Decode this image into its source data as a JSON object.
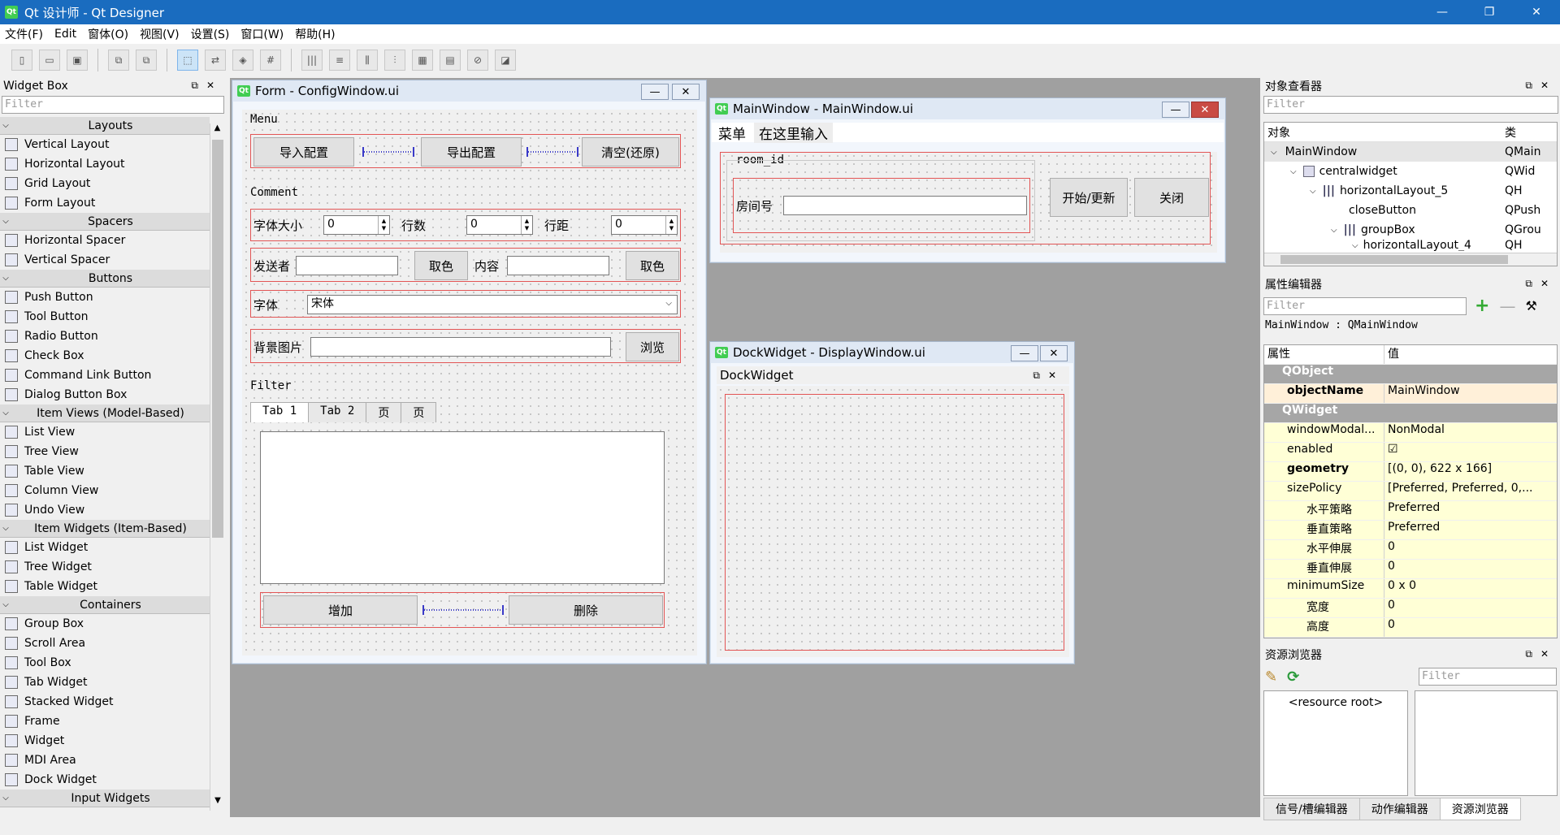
{
  "app": {
    "title": "Qt 设计师 - Qt Designer",
    "logo_text": "Qt"
  },
  "menu": [
    "文件(F)",
    "Edit",
    "窗体(O)",
    "视图(V)",
    "设置(S)",
    "窗口(W)",
    "帮助(H)"
  ],
  "widget_box": {
    "title": "Widget Box",
    "filter_placeholder": "Filter",
    "categories": [
      {
        "name": "Layouts",
        "items": [
          "Vertical Layout",
          "Horizontal Layout",
          "Grid Layout",
          "Form Layout"
        ]
      },
      {
        "name": "Spacers",
        "items": [
          "Horizontal Spacer",
          "Vertical Spacer"
        ]
      },
      {
        "name": "Buttons",
        "items": [
          "Push Button",
          "Tool Button",
          "Radio Button",
          "Check Box",
          "Command Link Button",
          "Dialog Button Box"
        ]
      },
      {
        "name": "Item Views (Model-Based)",
        "items": [
          "List View",
          "Tree View",
          "Table View",
          "Column View",
          "Undo View"
        ]
      },
      {
        "name": "Item Widgets (Item-Based)",
        "items": [
          "List Widget",
          "Tree Widget",
          "Table Widget"
        ]
      },
      {
        "name": "Containers",
        "items": [
          "Group Box",
          "Scroll Area",
          "Tool Box",
          "Tab Widget",
          "Stacked Widget",
          "Frame",
          "Widget",
          "MDI Area",
          "Dock Widget"
        ]
      },
      {
        "name": "Input Widgets",
        "items": []
      }
    ]
  },
  "config_window": {
    "title": "Form - ConfigWindow.ui",
    "menu_label": "Menu",
    "import_btn": "导入配置",
    "export_btn": "导出配置",
    "clear_btn": "清空(还原)",
    "comment_label": "Comment",
    "font_size_label": "字体大小",
    "font_size_val": "0",
    "rows_label": "行数",
    "rows_val": "0",
    "spacing_label": "行距",
    "spacing_val": "0",
    "sender_label": "发送者",
    "pick_color_1": "取色",
    "content_label": "内容",
    "pick_color_2": "取色",
    "font_label": "字体",
    "font_val": "宋体",
    "bg_label": "背景图片",
    "browse_btn": "浏览",
    "filter_label": "Filter",
    "tabs": [
      "Tab 1",
      "Tab 2",
      "页",
      "页"
    ],
    "add_btn": "增加",
    "delete_btn": "删除"
  },
  "main_window": {
    "title": "MainWindow - MainWindow.ui",
    "menu_item": "菜单",
    "menu_input": "在这里输入",
    "group_title": "room_id",
    "room_label": "房间号",
    "start_btn": "开始/更新",
    "close_btn": "关闭"
  },
  "dock_window": {
    "title": "DockWidget - DisplayWindow.ui",
    "dock_title": "DockWidget"
  },
  "object_inspector": {
    "title": "对象查看器",
    "filter_placeholder": "Filter",
    "col_object": "对象",
    "col_class": "类",
    "rows": [
      {
        "name": "MainWindow",
        "cls": "QMain"
      },
      {
        "name": "centralwidget",
        "cls": "QWid"
      },
      {
        "name": "horizontalLayout_5",
        "cls": "QH"
      },
      {
        "name": "closeButton",
        "cls": "QPush"
      },
      {
        "name": "groupBox",
        "cls": "QGrou"
      },
      {
        "name": "horizontalLayout_4",
        "cls": "QH"
      }
    ]
  },
  "property_editor": {
    "title": "属性编辑器",
    "filter_placeholder": "Filter",
    "context": "MainWindow : QMainWindow",
    "col_prop": "属性",
    "col_val": "值",
    "rows": [
      {
        "type": "cat",
        "name": "QObject",
        "val": ""
      },
      {
        "type": "o",
        "name": "objectName",
        "val": "MainWindow"
      },
      {
        "type": "cat",
        "name": "QWidget",
        "val": ""
      },
      {
        "type": "y",
        "name": "windowModal...",
        "val": "NonModal"
      },
      {
        "type": "y",
        "name": "enabled",
        "val": "☑"
      },
      {
        "type": "y",
        "name": "geometry",
        "val": "[(0, 0), 622 x 166]"
      },
      {
        "type": "y",
        "name": "sizePolicy",
        "val": "[Preferred, Preferred, 0,..."
      },
      {
        "type": "ys",
        "name": "水平策略",
        "val": "Preferred"
      },
      {
        "type": "ys",
        "name": "垂直策略",
        "val": "Preferred"
      },
      {
        "type": "ys",
        "name": "水平伸展",
        "val": "0"
      },
      {
        "type": "ys",
        "name": "垂直伸展",
        "val": "0"
      },
      {
        "type": "y",
        "name": "minimumSize",
        "val": "0 x 0"
      },
      {
        "type": "ys",
        "name": "宽度",
        "val": "0"
      },
      {
        "type": "ys",
        "name": "高度",
        "val": "0"
      }
    ]
  },
  "resource_browser": {
    "title": "资源浏览器",
    "filter_placeholder": "Filter",
    "root": "<resource root>"
  },
  "bottom_tabs": [
    "信号/槽编辑器",
    "动作编辑器",
    "资源浏览器"
  ]
}
